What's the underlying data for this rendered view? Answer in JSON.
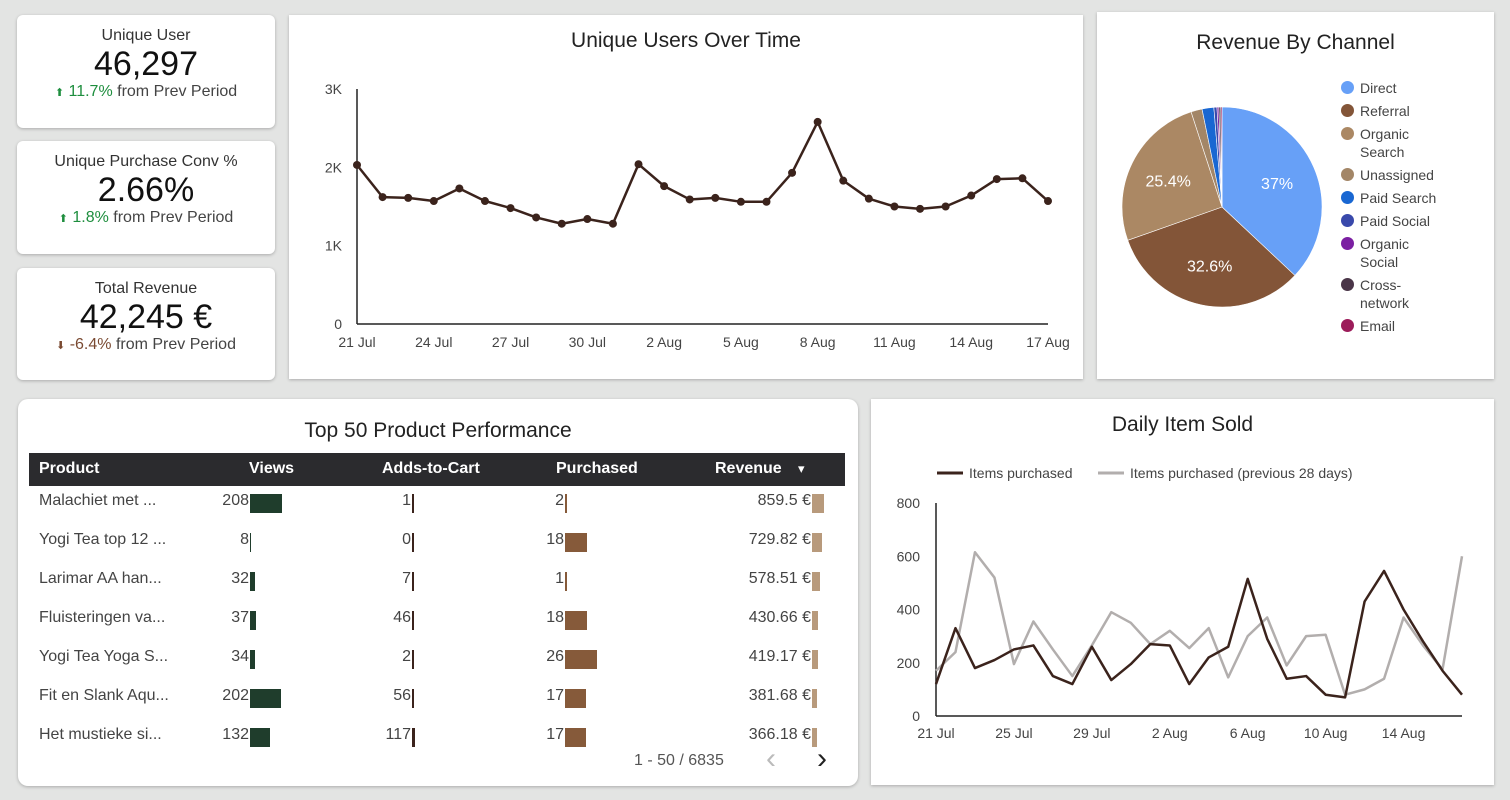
{
  "kpis": [
    {
      "label": "Unique User",
      "value": "46,297",
      "arrow": "⬆",
      "pct": "11.7%",
      "suffix": "from Prev Period"
    },
    {
      "label": "Unique Purchase Conv %",
      "value": "2.66%",
      "arrow": "⬆",
      "pct": "1.8%",
      "suffix": "from Prev Period"
    },
    {
      "label": "Total Revenue",
      "value": "42,245 €",
      "arrow": "⬇",
      "pct": "-6.4%",
      "suffix": "from Prev Period"
    }
  ],
  "colors": {
    "line_dark": "#3b231c",
    "line_gray": "#b2aead",
    "views_bar": "#1f3d2c",
    "purch_bar": "#865a3a",
    "rev_bar": "#b89a7c"
  },
  "chart_data": [
    {
      "type": "line",
      "title": "Unique Users Over Time",
      "x": [
        "21 Jul",
        "22 Jul",
        "23 Jul",
        "24 Jul",
        "25 Jul",
        "26 Jul",
        "27 Jul",
        "28 Jul",
        "29 Jul",
        "30 Jul",
        "31 Jul",
        "1 Aug",
        "2 Aug",
        "3 Aug",
        "4 Aug",
        "5 Aug",
        "6 Aug",
        "7 Aug",
        "8 Aug",
        "9 Aug",
        "10 Aug",
        "11 Aug",
        "12 Aug",
        "13 Aug",
        "14 Aug",
        "15 Aug",
        "16 Aug",
        "17 Aug",
        "18 Aug"
      ],
      "values": [
        2030,
        1620,
        1610,
        1570,
        1730,
        1570,
        1480,
        1360,
        1280,
        1340,
        1280,
        2040,
        1760,
        1590,
        1610,
        1560,
        1560,
        1930,
        2580,
        1830,
        1600,
        1500,
        1470,
        1500,
        1640,
        1850,
        1860,
        1570
      ],
      "x_ticks": [
        "21 Jul",
        "24 Jul",
        "27 Jul",
        "30 Jul",
        "2 Aug",
        "5 Aug",
        "8 Aug",
        "11 Aug",
        "14 Aug",
        "17 Aug"
      ],
      "y_ticks": [
        "0",
        "1K",
        "2K",
        "3K"
      ],
      "ylim": [
        0,
        3000
      ],
      "color": "#3b231c"
    },
    {
      "type": "pie",
      "title": "Revenue By Channel",
      "slices": [
        {
          "label": "Direct",
          "value": 37,
          "color": "#67a0f7",
          "show": "37%"
        },
        {
          "label": "Referral",
          "value": 32.6,
          "color": "#835538",
          "show": "32.6%"
        },
        {
          "label": "Organic Search",
          "value": 25.4,
          "color": "#ab8864",
          "show": "25.4%"
        },
        {
          "label": "Unassigned",
          "value": 1.8,
          "color": "#a38667",
          "show": ""
        },
        {
          "label": "Paid Search",
          "value": 1.9,
          "color": "#1967d2",
          "show": ""
        },
        {
          "label": "Paid Social",
          "value": 0.5,
          "color": "#3949ab",
          "show": ""
        },
        {
          "label": "Organic Social",
          "value": 0.3,
          "color": "#7b1fa2",
          "show": ""
        },
        {
          "label": "Cross-network",
          "value": 0.3,
          "color": "#4a3548",
          "show": ""
        },
        {
          "label": "Email",
          "value": 0.2,
          "color": "#9c1c5a",
          "show": ""
        }
      ],
      "legend": [
        "Direct",
        "Referral",
        "Organic Search",
        "Unassigned",
        "Paid Search",
        "Paid Social",
        "Organic Social",
        "Cross-network",
        "Email"
      ],
      "legend_lines": [
        [
          "Direct"
        ],
        [
          "Referral"
        ],
        [
          "Organic",
          "Search"
        ],
        [
          "Unassigned"
        ],
        [
          "Paid Search"
        ],
        [
          "Paid Social"
        ],
        [
          "Organic",
          "Social"
        ],
        [
          "Cross-",
          "network"
        ],
        [
          "Email"
        ]
      ]
    },
    {
      "type": "line",
      "title": "Daily Item Sold",
      "x": [
        "21 Jul",
        "22 Jul",
        "23 Jul",
        "24 Jul",
        "25 Jul",
        "26 Jul",
        "27 Jul",
        "28 Jul",
        "29 Jul",
        "30 Jul",
        "31 Jul",
        "1 Aug",
        "2 Aug",
        "3 Aug",
        "4 Aug",
        "5 Aug",
        "6 Aug",
        "7 Aug",
        "8 Aug",
        "9 Aug",
        "10 Aug",
        "11 Aug",
        "12 Aug",
        "13 Aug",
        "14 Aug",
        "15 Aug",
        "16 Aug",
        "17 Aug"
      ],
      "x_ticks": [
        "21 Jul",
        "25 Jul",
        "29 Jul",
        "2 Aug",
        "6 Aug",
        "10 Aug",
        "14 Aug"
      ],
      "y_ticks": [
        "0",
        "200",
        "400",
        "600",
        "800"
      ],
      "ylim": [
        0,
        800
      ],
      "series": [
        {
          "name": "Items purchased",
          "color": "#3b231c",
          "values": [
            120,
            330,
            180,
            210,
            250,
            265,
            150,
            120,
            260,
            135,
            195,
            270,
            265,
            120,
            220,
            260,
            515,
            290,
            140,
            150,
            80,
            70,
            430,
            545,
            400,
            280,
            170,
            80
          ]
        },
        {
          "name": "Items purchased (previous 28 days)",
          "color": "#b2aead",
          "values": [
            170,
            240,
            615,
            520,
            195,
            355,
            250,
            150,
            265,
            390,
            350,
            270,
            320,
            255,
            330,
            145,
            300,
            370,
            190,
            300,
            305,
            80,
            100,
            140,
            370,
            265,
            175,
            600
          ]
        }
      ]
    }
  ],
  "table": {
    "title": "Top 50 Product Performance",
    "headers": [
      "Product",
      "Views",
      "Adds-to-Cart",
      "Purchased",
      "Revenue"
    ],
    "sort_indicator": "▾",
    "rows": [
      {
        "product": "Malachiet met ...",
        "views": 208,
        "views_s": "208",
        "adds": 1,
        "adds_s": "1",
        "purch": 2,
        "purch_s": "2",
        "rev": 859.5,
        "rev_s": "859.5 €"
      },
      {
        "product": "Yogi Tea top 12 ...",
        "views": 8,
        "views_s": "8",
        "adds": 0,
        "adds_s": "0",
        "purch": 18,
        "purch_s": "18",
        "rev": 729.82,
        "rev_s": "729.82 €"
      },
      {
        "product": "Larimar AA han...",
        "views": 32,
        "views_s": "32",
        "adds": 7,
        "adds_s": "7",
        "purch": 1,
        "purch_s": "1",
        "rev": 578.51,
        "rev_s": "578.51 €"
      },
      {
        "product": "Fluisteringen va...",
        "views": 37,
        "views_s": "37",
        "adds": 46,
        "adds_s": "46",
        "purch": 18,
        "purch_s": "18",
        "rev": 430.66,
        "rev_s": "430.66 €"
      },
      {
        "product": "Yogi Tea Yoga S...",
        "views": 34,
        "views_s": "34",
        "adds": 2,
        "adds_s": "2",
        "purch": 26,
        "purch_s": "26",
        "rev": 419.17,
        "rev_s": "419.17 €"
      },
      {
        "product": "Fit en Slank Aqu...",
        "views": 202,
        "views_s": "202",
        "adds": 56,
        "adds_s": "56",
        "purch": 17,
        "purch_s": "17",
        "rev": 381.68,
        "rev_s": "381.68 €"
      },
      {
        "product": "Het mustieke si...",
        "views": 132,
        "views_s": "132",
        "adds": 117,
        "adds_s": "117",
        "purch": 17,
        "purch_s": "17",
        "rev": 366.18,
        "rev_s": "366.18 €"
      }
    ],
    "pager": "1 - 50 / 6835",
    "prev_icon": "‹",
    "next_icon": "›"
  }
}
